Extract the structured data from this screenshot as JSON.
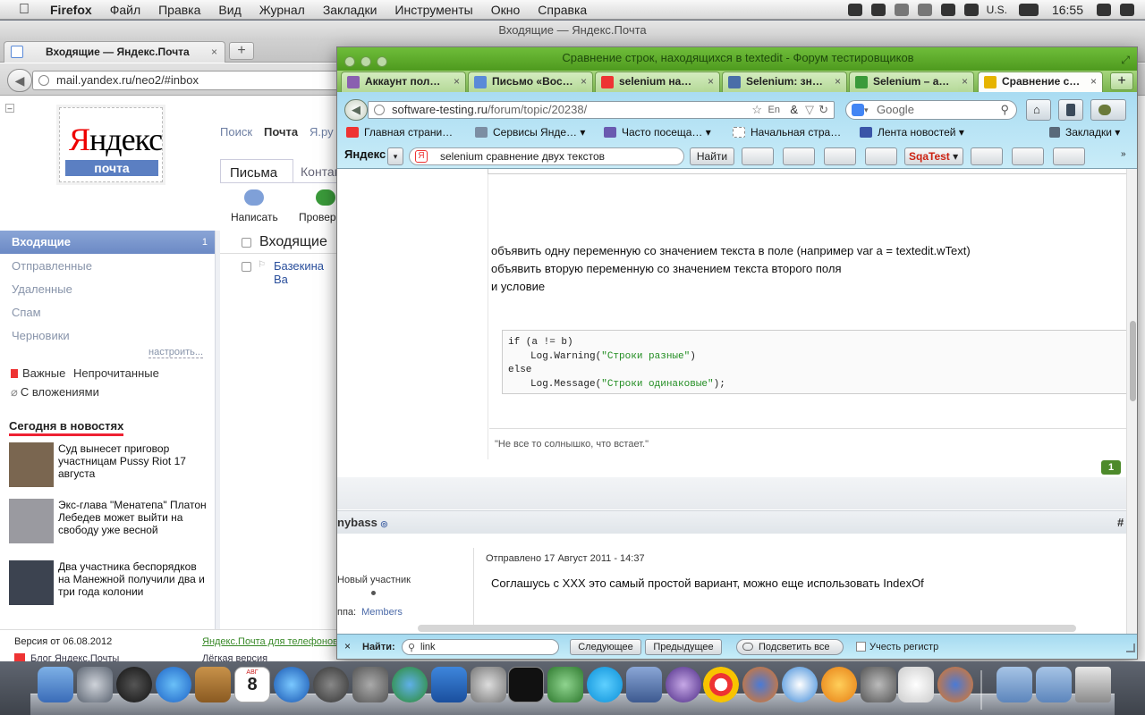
{
  "menubar": {
    "app": "Firefox",
    "items": [
      "Файл",
      "Правка",
      "Вид",
      "Журнал",
      "Закладки",
      "Инструменты",
      "Окно",
      "Справка"
    ],
    "locale": "U.S.",
    "clock": "16:55"
  },
  "back_window": {
    "title": "Входящие — Яндекс.Почта",
    "tab_label": "Входящие — Яндекс.Почта",
    "url": "mail.yandex.ru/neo2/#inbox",
    "yandex": {
      "logo_text_1": "Я",
      "logo_text_2": "ндекс",
      "logo_sub": "почта",
      "top_links": [
        "Поиск",
        "Почта",
        "Я.ру"
      ],
      "tabs": [
        "Письма",
        "Контакты"
      ],
      "actions": [
        "Написать",
        "Проверить"
      ],
      "folders": {
        "inbox": "Входящие",
        "inbox_count": "1",
        "sent": "Отправленные",
        "deleted": "Удаленные",
        "spam": "Спам",
        "drafts": "Черновики",
        "configure": "настроить..."
      },
      "labels": {
        "important": "Важные",
        "unread": "Непрочитанные",
        "attachments": "С вложениями"
      },
      "news_header": "Сегодня в новостях",
      "news": [
        "Суд вынесет приговор участницам Pussy Riot 17 августа",
        "Экс-глава \"Менатепа\" Платон Лебедев может выйти на свободу уже весной",
        "Два участника беспорядков на Манежной получили два и три года колонии"
      ],
      "list_header": "Входящие",
      "list_first_sender": "Базекина Ва",
      "footer": {
        "version": "Версия от 06.08.2012",
        "phone_link": "Яндекс.Почта для телефонов",
        "blog_link": "Блог Яндекс.Почты",
        "lite_link": "Лёгкая версия"
      }
    }
  },
  "front_window": {
    "title": "Сравнение строк, находящихся в textedit - Форум тестировщиков",
    "tabs": [
      {
        "label": "Аккаунт пол…",
        "close": "×"
      },
      {
        "label": "Письмо «Вос…",
        "close": "×"
      },
      {
        "label": "selenium на…",
        "close": "×"
      },
      {
        "label": "Selenium: зн…",
        "close": "×"
      },
      {
        "label": "Selenium – а…",
        "close": "×"
      },
      {
        "label": "Сравнение с…",
        "close": "×"
      }
    ],
    "url_host": "software-testing.ru",
    "url_path": "/forum/topic/20238/",
    "search_engine": "Google",
    "bookmarks": [
      "Главная страни…",
      "Сервисы Янде…",
      "Часто посеща…",
      "Начальная стра…",
      "Лента новостей",
      "Закладки"
    ],
    "yandex_bar": {
      "logo": "Яндекс",
      "query": "selenium сравнение двух текстов",
      "find_button": "Найти",
      "sqa": "SqaTest"
    },
    "post": {
      "line1": "объявить одну переменную со значением текста в поле (например var a = textedit.wText)",
      "line2": "объявить вторую переменную со значением текста второго поля",
      "line3": "и условие",
      "code": {
        "l1": "if (a != b)",
        "l2_fn": "Log.Warning(",
        "l2_str": "\"Строки разные\"",
        "l2_end": ")",
        "l3": "else",
        "l4_fn": "Log.Message(",
        "l4_str": "\"Строки одинаковые\"",
        "l4_end": ");"
      },
      "signature": "\"Не все то солнышко, что встает.\"",
      "page_badge": "1"
    },
    "reply": {
      "author": "nybass",
      "hash": "#",
      "posted": "Отправлено 17 Август 2011 - 14:37",
      "role": "Новый участник",
      "group_label": "ппа:",
      "group_value": "Members",
      "text": "Соглашусь с XXX это самый простой вариант, можно еще использовать IndexOf"
    },
    "findbar": {
      "label": "Найти:",
      "query": "link",
      "next": "Следующее",
      "prev": "Предыдущее",
      "highlight": "Подсветить все",
      "match_case": "Учесть регистр"
    }
  },
  "dock": {
    "calendar_day": "8",
    "calendar_month": "АВГ"
  }
}
